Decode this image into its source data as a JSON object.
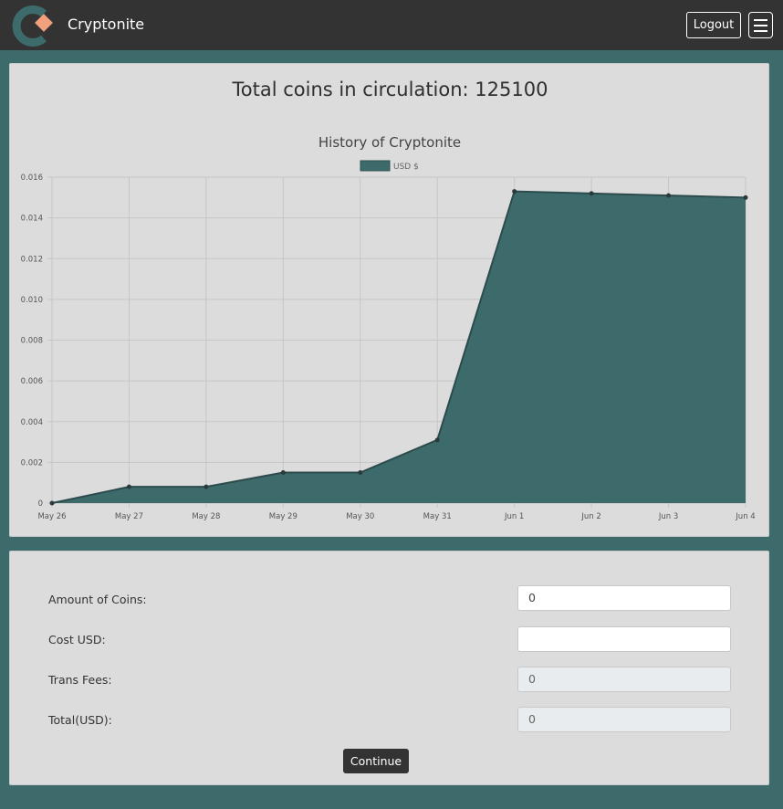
{
  "navbar": {
    "brand": "Cryptonite",
    "logout_label": "Logout",
    "logo_colors": {
      "ring": "#3d6b6c",
      "diamond": "#f0a07c"
    }
  },
  "summary": {
    "title": "Total coins in circulation: 125100"
  },
  "chart_data": {
    "type": "area",
    "title": "History of Cryptonite",
    "categories": [
      "May 26",
      "May 27",
      "May 28",
      "May 29",
      "May 30",
      "May 31",
      "Jun 1",
      "Jun 2",
      "Jun 3",
      "Jun 4"
    ],
    "series": [
      {
        "name": "USD $",
        "values": [
          0,
          0.0008,
          0.0008,
          0.0015,
          0.0015,
          0.0031,
          0.0153,
          0.0152,
          0.0151,
          0.015
        ],
        "color": "#3d6b6c"
      }
    ],
    "y_ticks": [
      "0",
      "0.002",
      "0.004",
      "0.006",
      "0.008",
      "0.010",
      "0.012",
      "0.014",
      "0.016"
    ],
    "ylim": [
      0,
      0.016
    ],
    "grid": true,
    "legend": "top"
  },
  "form": {
    "fields": [
      {
        "label": "Amount of Coins:",
        "value": "0"
      },
      {
        "label": "Cost USD:",
        "value": ""
      },
      {
        "label": "Trans Fees:",
        "value": "0"
      },
      {
        "label": "Total(USD):",
        "value": "0"
      }
    ],
    "continue_label": "Continue"
  }
}
